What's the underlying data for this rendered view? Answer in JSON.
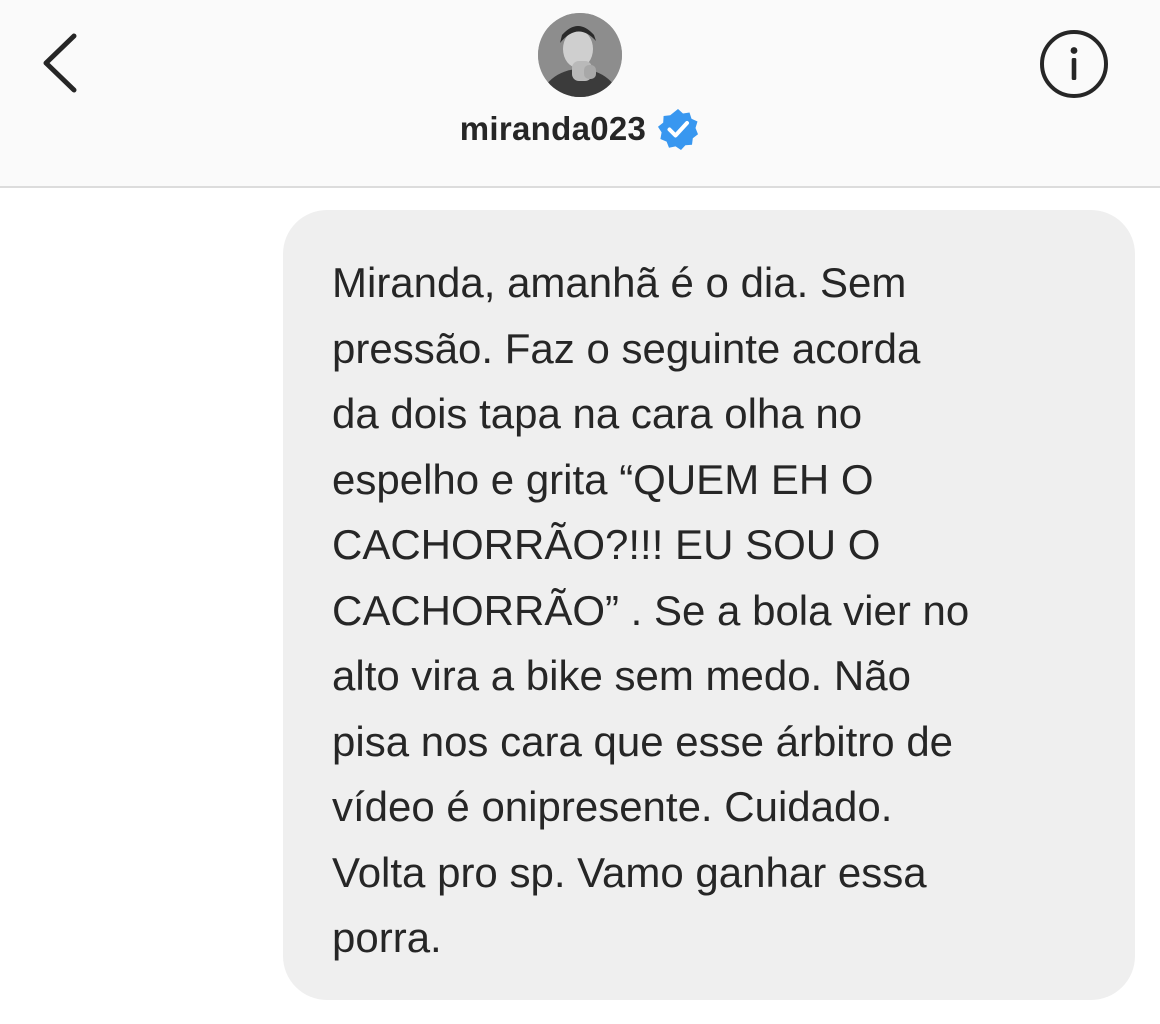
{
  "header": {
    "username": "miranda023",
    "verified": true,
    "accent_color": "#3897f0"
  },
  "icons": {
    "back": "chevron-left-icon",
    "info": "info-circle-icon",
    "verified": "verified-badge-icon"
  },
  "message": {
    "direction": "incoming",
    "bubble_color": "#efefef",
    "text": "Miranda, amanhã é o dia. Sem\npressão. Faz o seguinte acorda\nda dois tapa na cara olha no\nespelho e grita “QUEM EH O\nCACHORRÃO?!!! EU SOU O\nCACHORRÃO” . Se a bola vier no\nalto vira a bike sem medo. Não\npisa nos cara que esse árbitro de\nvídeo é onipresente. Cuidado.\nVolta pro sp. Vamo ganhar essa\nporra."
  }
}
